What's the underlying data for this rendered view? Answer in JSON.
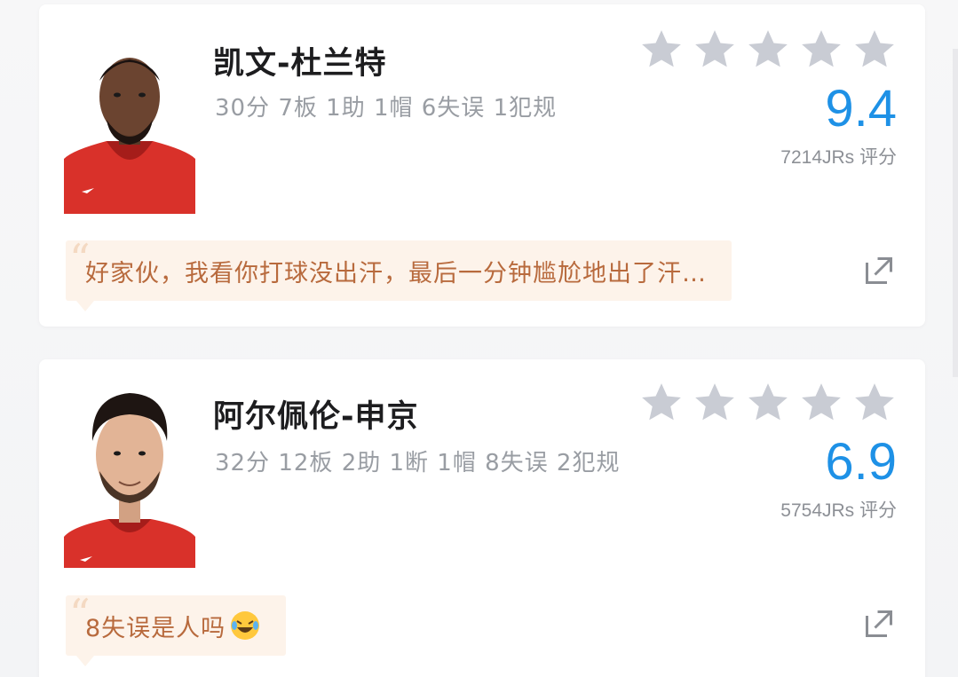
{
  "players": [
    {
      "name": "凯文-杜兰特",
      "stats": "30分 7板 1助 1帽 6失误 1犯规",
      "score": "9.4",
      "raters": "7214JRs 评分",
      "stars_filled": 0,
      "comment": "好家伙，我看你打球没出汗，最后一分钟尴尬地出了汗…"
    },
    {
      "name": "阿尔佩伦-申京",
      "stats": "32分 12板 2助 1断 1帽 8失误 2犯规",
      "score": "6.9",
      "raters": "5754JRs 评分",
      "stars_filled": 0,
      "comment": "8失误是人吗"
    }
  ],
  "icons": {
    "star": "star-icon",
    "share": "share-icon",
    "emoji": "laughing-crying-emoji-icon"
  },
  "colors": {
    "score_blue": "#1e91e6",
    "star_gray": "#c9ccd4",
    "comment_bg": "#fdf3ea",
    "comment_text": "#b86a3d",
    "jersey_red": "#d9312a"
  }
}
